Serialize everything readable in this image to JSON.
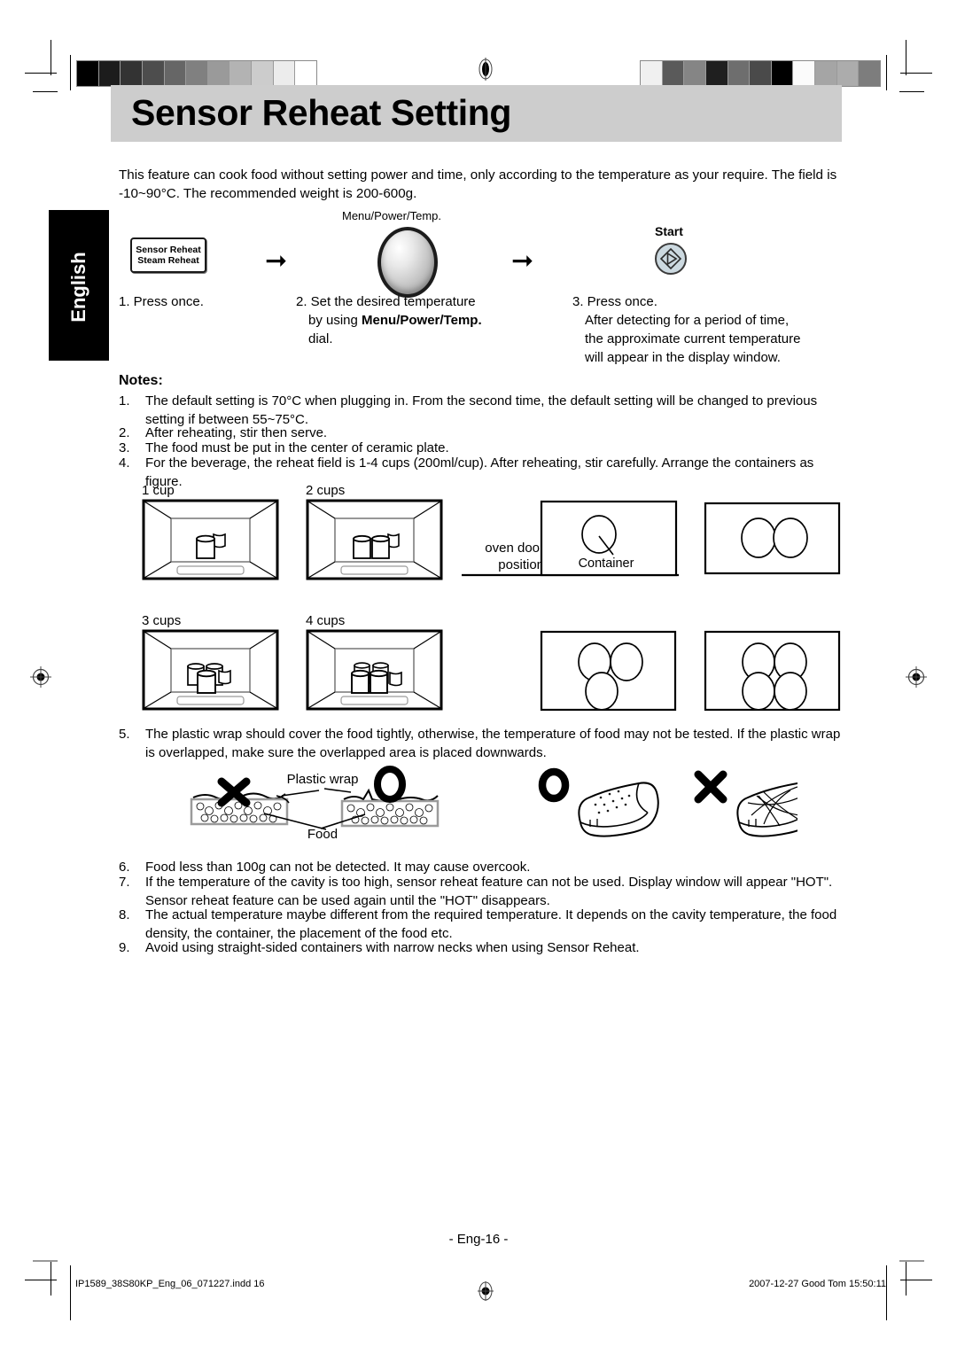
{
  "document": {
    "title": "Sensor Reheat Setting",
    "language_tab": "English",
    "intro": "This feature can cook food without setting power and time, only according to the temperature as your require. The field is -10~90°C. The recommended weight is 200-600g."
  },
  "steps": {
    "button_line1": "Sensor Reheat",
    "button_line2": "Steam Reheat",
    "dial_label": "Menu/Power/Temp.",
    "start_label": "Start",
    "arrow_glyph": "➞",
    "caption_1": "1. Press once.",
    "caption_2_pre": "2. Set the desired temperature",
    "caption_2_mid": "by using ",
    "caption_2_bold": "Menu/Power/Temp.",
    "caption_2_end": "dial.",
    "caption_3_l1": "3. Press once.",
    "caption_3_l2": "After detecting for a period of time,",
    "caption_3_l3": "the approximate current temperature",
    "caption_3_l4": "will appear in the display window."
  },
  "notes": {
    "heading": "Notes:",
    "items": [
      {
        "num": "1.",
        "text": "The default setting is 70°C when plugging in. From the second time, the default setting will be changed to previous setting if between 55~75°C."
      },
      {
        "num": "2.",
        "text": "After reheating, stir then serve."
      },
      {
        "num": "3.",
        "text": "The food must be put in the center of ceramic plate."
      },
      {
        "num": "4.",
        "text": "For the beverage, the reheat field is 1-4 cups (200ml/cup). After reheating, stir carefully. Arrange the containers as figure."
      },
      {
        "num": "5.",
        "text": "The plastic wrap should cover the food tightly, otherwise, the temperature of food may not be tested. If the plastic wrap is overlapped, make sure the overlapped area is placed downwards."
      },
      {
        "num": "6.",
        "text": "Food less than 100g can not be detected. It may cause overcook."
      },
      {
        "num": "7.",
        "text": "If the temperature of the cavity is too high, sensor reheat feature can not be used. Display window will appear \"HOT\". Sensor reheat feature can be used again until the \"HOT\" disappears."
      },
      {
        "num": "8.",
        "text": "The actual temperature maybe different from the required temperature. It depends on the cavity temperature, the food density, the container, the placement of the food etc."
      },
      {
        "num": "9.",
        "text": "Avoid using straight-sided containers with narrow necks when using Sensor Reheat."
      }
    ]
  },
  "cup_figures": {
    "label_1": "1 cup",
    "label_2": "2 cups",
    "label_3": "3 cups",
    "label_4": "4 cups",
    "oven_door_l1": "oven door",
    "oven_door_l2": "position",
    "container_label": "Container"
  },
  "wrap_figures": {
    "plastic_wrap_label": "Plastic wrap",
    "food_label": "Food",
    "bad_mark": "✕",
    "good_mark": "O"
  },
  "footer": {
    "page_number": "- Eng-16 -",
    "file_name": "IP1589_38S80KP_Eng_06_071227.indd   16",
    "date_stamp": "2007-12-27   Good Tom 15:50:11"
  },
  "calibration": {
    "left_bar": [
      "#000000",
      "#1c1c1c",
      "#333333",
      "#4d4d4d",
      "#666666",
      "#808080",
      "#9a9a9a",
      "#b3b3b3",
      "#cccccc",
      "#ececec",
      "#ffffff"
    ],
    "right_bar": [
      "#f0f0f0",
      "#5a5a5a",
      "#858585",
      "#1f1f1f",
      "#6e6e6e",
      "#4a4a4a",
      "#000000",
      "#fbfbfb",
      "#a5a5a5",
      "#acacac",
      "#7d7d7d"
    ]
  },
  "colors": {
    "banner": "#cdcdcd",
    "tab": "#000000",
    "start_button": "#ccd9e0"
  }
}
